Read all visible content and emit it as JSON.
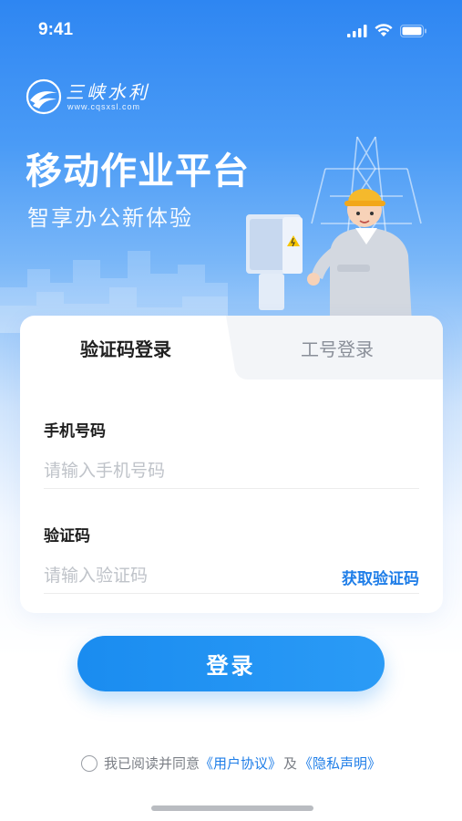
{
  "status_bar": {
    "time": "9:41",
    "icons": [
      "signal-icon",
      "wifi-icon",
      "battery-icon"
    ]
  },
  "brand": {
    "name": "三峡水利",
    "url": "www.cqsxsl.com",
    "logo_icon": "wave-logo-icon"
  },
  "hero": {
    "title": "移动作业平台",
    "subtitle": "智享办公新体验",
    "illustration": "worker-with-power-cabinet-illustration"
  },
  "tabs": [
    {
      "label": "验证码登录",
      "active": true
    },
    {
      "label": "工号登录",
      "active": false
    }
  ],
  "form": {
    "phone": {
      "label": "手机号码",
      "placeholder": "请输入手机号码",
      "value": ""
    },
    "code": {
      "label": "验证码",
      "placeholder": "请输入验证码",
      "value": "",
      "action_label": "获取验证码"
    }
  },
  "login_button": {
    "label": "登录"
  },
  "agreement": {
    "checked": false,
    "prefix": "我已阅读并同意",
    "user_agreement": "《用户协议》",
    "joiner": "及",
    "privacy": "《隐私声明》"
  },
  "colors": {
    "primary": "#1f7ee8",
    "hero_top": "#2e86f2",
    "button": "#1a8cf0",
    "text": "#1f1f1f",
    "placeholder": "#bfc3c9"
  }
}
